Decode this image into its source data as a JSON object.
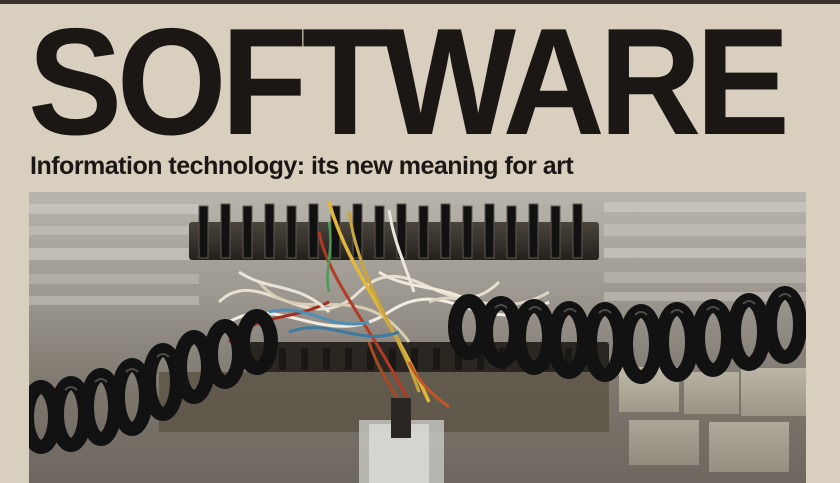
{
  "cover": {
    "title": "SOFTWARE",
    "subtitle": "Information technology: its new meaning for art"
  },
  "photo": {
    "subject": "",
    "colors": {
      "background": "#d8cfbf",
      "text": "#1a1715",
      "board": "#2b2824",
      "cable": "#121212"
    }
  }
}
